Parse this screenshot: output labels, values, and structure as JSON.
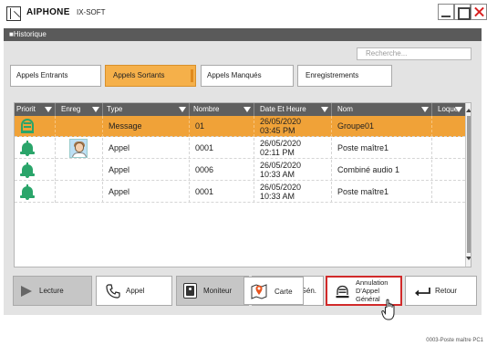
{
  "window": {
    "brand": "AIPHONE",
    "product": "IX-SOFT"
  },
  "band": {
    "title": "■Historique"
  },
  "search": {
    "placeholder": "Recherche..."
  },
  "tabs": [
    {
      "label": "Appels Entrants",
      "active": false
    },
    {
      "label": "Appels Sortants",
      "active": true
    },
    {
      "label": "Appels Manqués",
      "active": false
    },
    {
      "label": "Enregistrements",
      "active": false
    }
  ],
  "table": {
    "columns": [
      "Priorit",
      "Enreg",
      "Type",
      "Nombre",
      "Date Et Heure",
      "Nom",
      "Loque"
    ],
    "rows": [
      {
        "priority_icon": "speaker-icon",
        "recording_icon": "",
        "type": "Message",
        "number": "01",
        "date": "26/05/2020",
        "time": "03:45 PM",
        "name": "Groupe01",
        "lock": "",
        "selected": true
      },
      {
        "priority_icon": "bell-icon",
        "recording_icon": "person-photo-icon",
        "type": "Appel",
        "number": "0001",
        "date": "26/05/2020",
        "time": "02:11 PM",
        "name": "Poste maître1",
        "lock": "",
        "selected": false
      },
      {
        "priority_icon": "bell-icon",
        "recording_icon": "",
        "type": "Appel",
        "number": "0006",
        "date": "26/05/2020",
        "time": "10:33 AM",
        "name": "Combiné audio 1",
        "lock": "",
        "selected": false
      },
      {
        "priority_icon": "bell-icon",
        "recording_icon": "",
        "type": "Appel",
        "number": "0001",
        "date": "26/05/2020",
        "time": "10:33 AM",
        "name": "Poste maître1",
        "lock": "",
        "selected": false
      }
    ]
  },
  "buttons": {
    "lecture": "Lecture",
    "appel": "Appel",
    "moniteur": "Moniteur",
    "app_gen": "App. Gén.",
    "annulation_line1": "Annulation",
    "annulation_line2": "D'Appel",
    "annulation_line3": "Général",
    "retour": "Retour",
    "carte": "Carte"
  },
  "status": {
    "text": "0003-Poste maître PC1"
  },
  "colors": {
    "accent": "#f0a238",
    "header": "#5f5f5f",
    "icon_green": "#2aa56a",
    "highlight": "#d12a2a"
  }
}
